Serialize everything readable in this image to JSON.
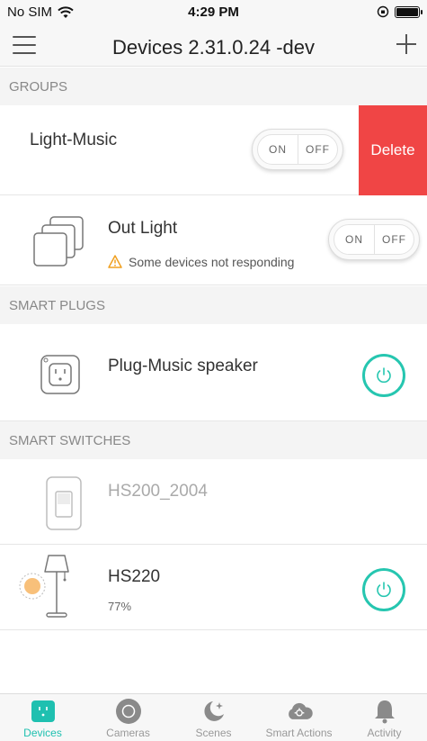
{
  "status_bar": {
    "carrier": "No SIM",
    "time": "4:29 PM"
  },
  "nav": {
    "title": "Devices 2.31.0.24 -dev",
    "menu_icon": "hamburger-icon",
    "add_icon": "plus-icon"
  },
  "sections": {
    "groups": "GROUPS",
    "smart_plugs": "SMART PLUGS",
    "smart_switches": "SMART SWITCHES"
  },
  "groups": [
    {
      "name": "Light-Music",
      "on_label": "ON",
      "off_label": "OFF",
      "delete_label": "Delete"
    },
    {
      "name": "Out Light",
      "warning": "Some devices not responding",
      "on_label": "ON",
      "off_label": "OFF"
    }
  ],
  "plugs": [
    {
      "name": "Plug-Music speaker",
      "power_on": true
    }
  ],
  "switches": [
    {
      "name": "HS200_2004",
      "offline": true
    },
    {
      "name": "HS220",
      "brightness": "77%",
      "power_on": true
    }
  ],
  "tabs": [
    {
      "label": "Devices",
      "icon": "plug-icon",
      "active": true
    },
    {
      "label": "Cameras",
      "icon": "camera-icon",
      "active": false
    },
    {
      "label": "Scenes",
      "icon": "moon-stars-icon",
      "active": false
    },
    {
      "label": "Smart Actions",
      "icon": "cloud-gear-icon",
      "active": false
    },
    {
      "label": "Activity",
      "icon": "bell-icon",
      "active": false
    }
  ],
  "colors": {
    "accent": "#26c6b0",
    "delete": "#f04545",
    "warning": "#f0a020"
  }
}
